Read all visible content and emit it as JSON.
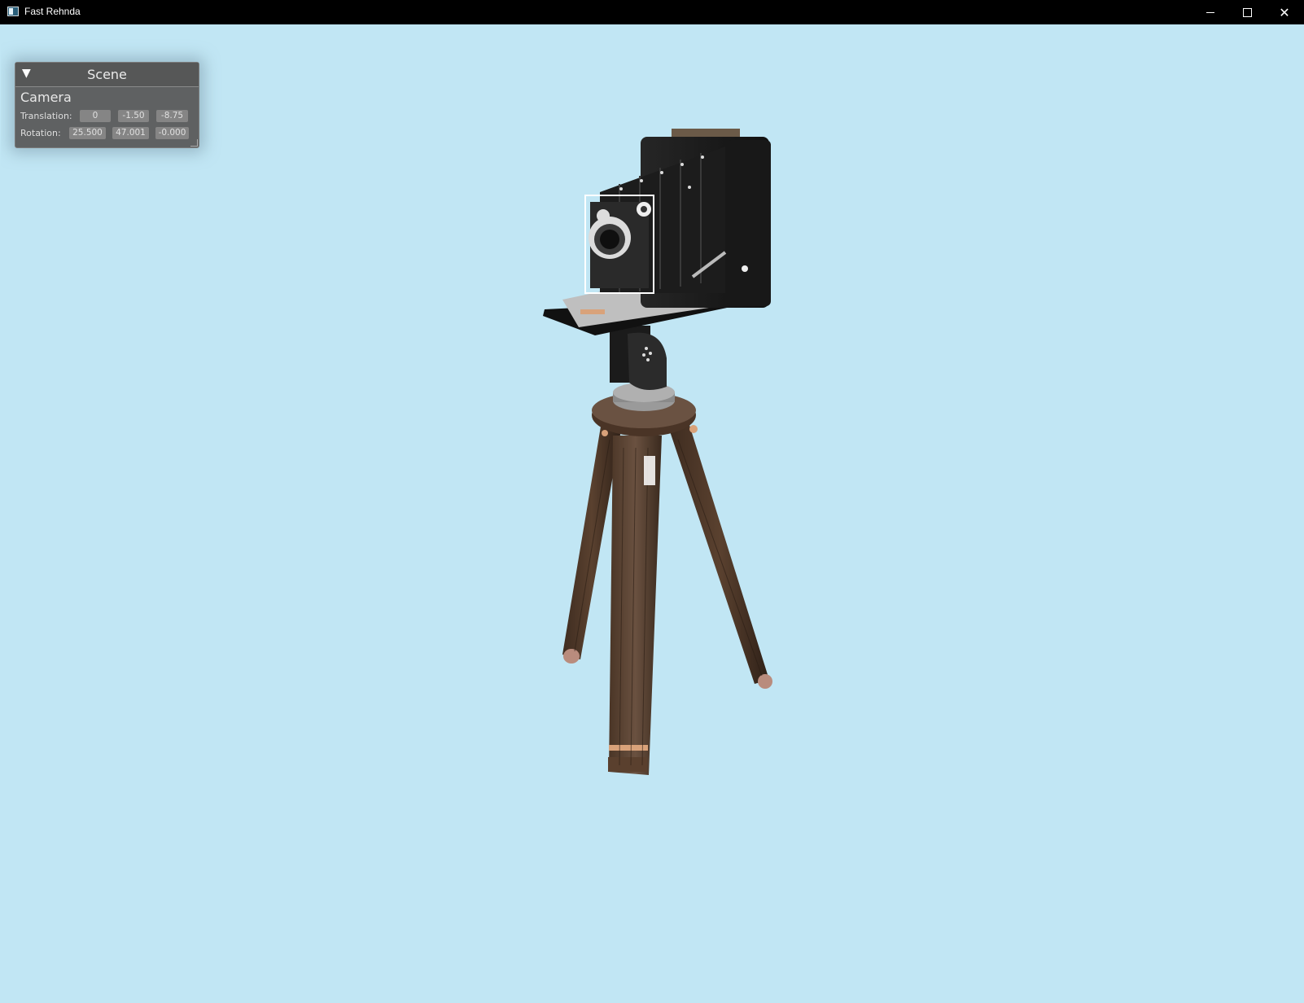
{
  "window": {
    "title": "Fast Rehnda",
    "app_icon": "app-icon",
    "controls": {
      "minimize_icon": "minimize-icon",
      "maximize_icon": "maximize-icon",
      "close_icon": "close-icon",
      "close_glyph": "✕"
    }
  },
  "viewport": {
    "background": "#c1e6f4"
  },
  "scene_panel": {
    "title": "Scene",
    "collapse_glyph": "▼",
    "section": "Camera",
    "translation": {
      "label": "Translation:",
      "values": [
        "0",
        "-1.50",
        "-8.75"
      ]
    },
    "rotation": {
      "label": "Rotation:",
      "values": [
        "25.500",
        "47.001",
        "-0.000"
      ]
    }
  }
}
